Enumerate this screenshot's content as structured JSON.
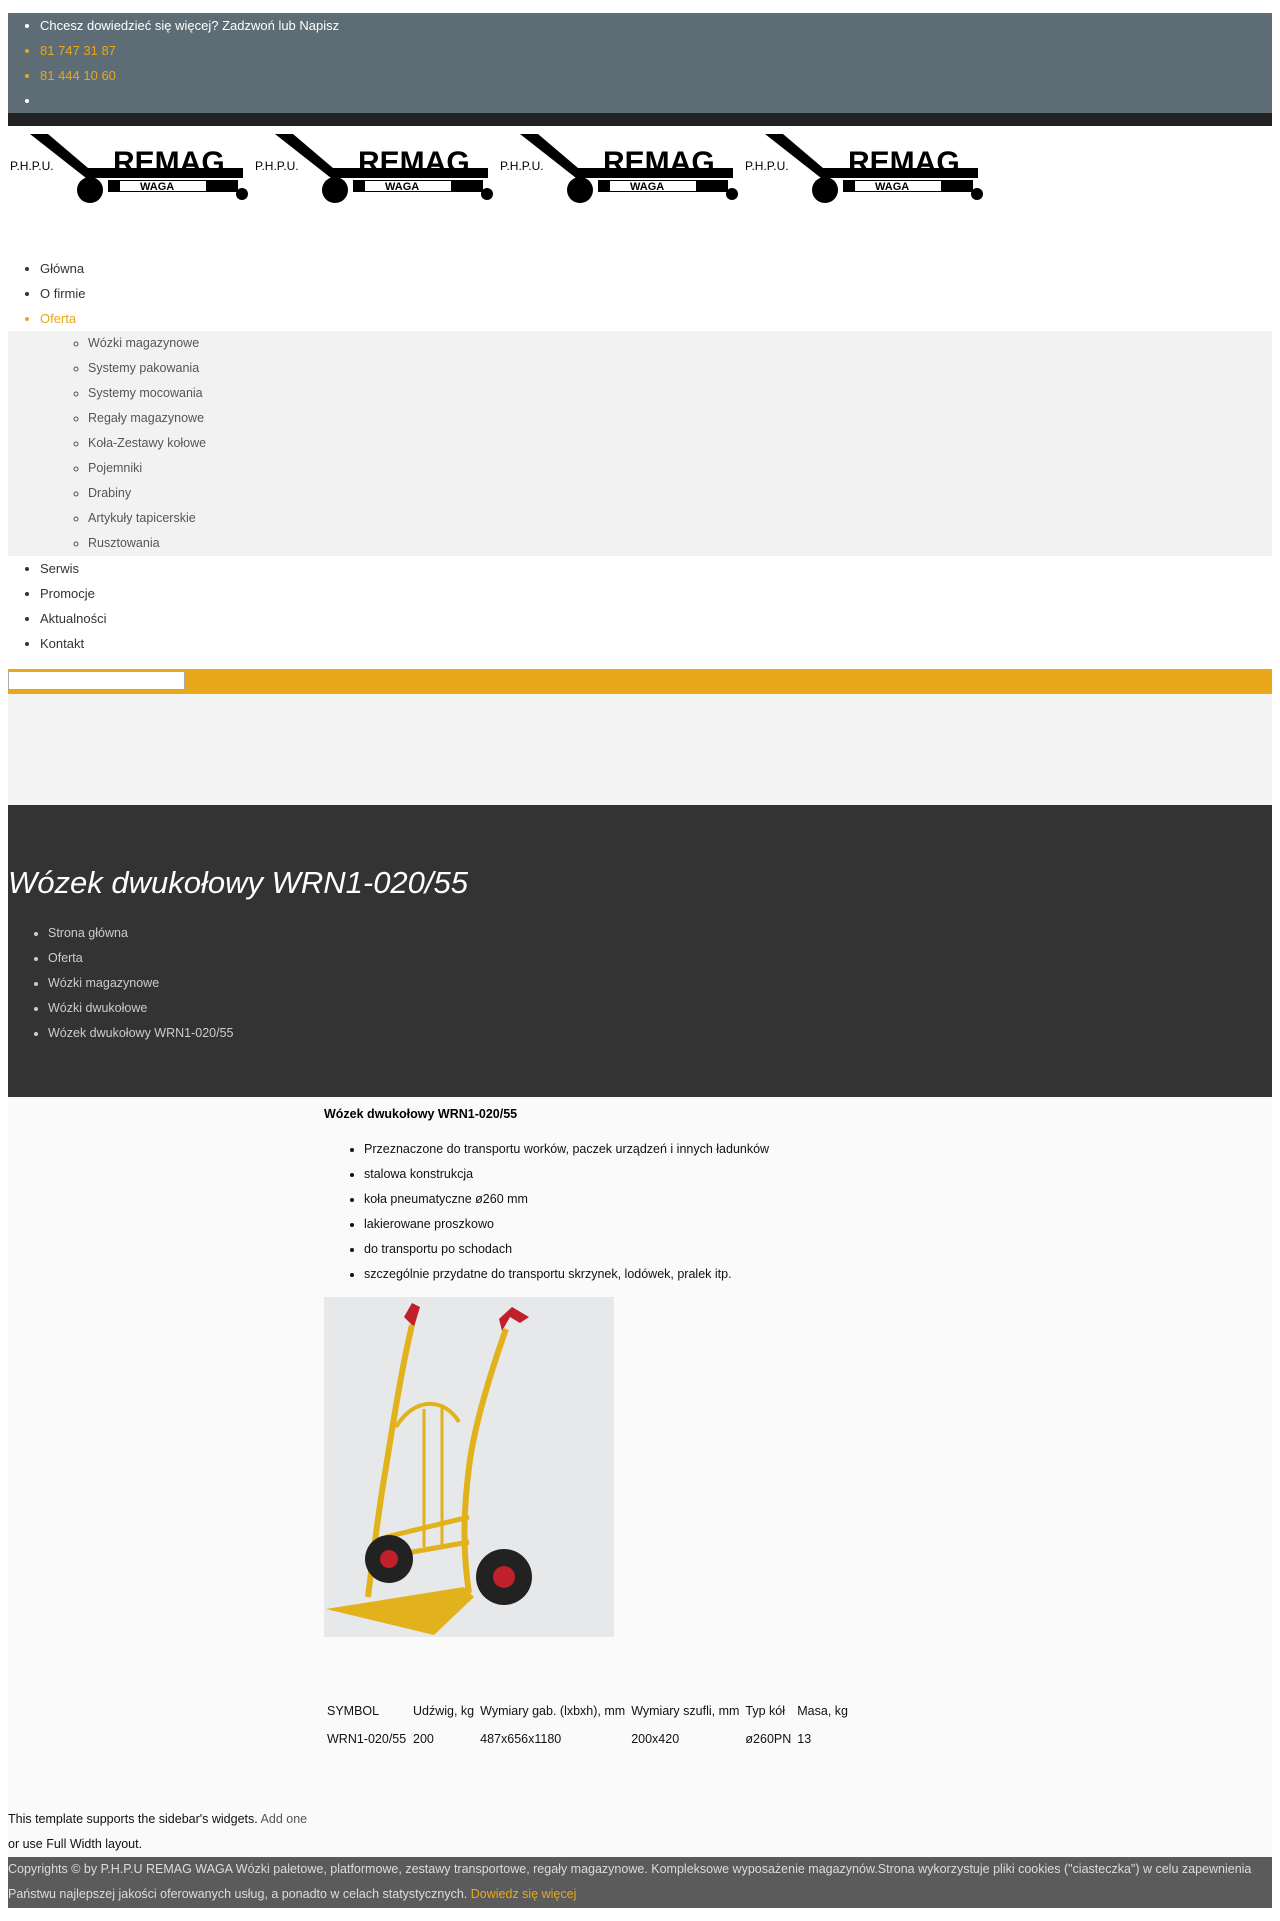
{
  "topbar": {
    "headline": "Chcesz dowiedzieć się więcej? Zadzwoń lub Napisz",
    "phone1": "81 747 31 87",
    "phone2": "81 444 10 60"
  },
  "logo": {
    "prefix": "P.H.P.U.",
    "brand": "REMAG",
    "sub": "WAGA"
  },
  "nav": {
    "items": [
      {
        "label": "Główna"
      },
      {
        "label": "O firmie"
      },
      {
        "label": "Oferta"
      },
      {
        "label": "Serwis"
      },
      {
        "label": "Promocje"
      },
      {
        "label": "Aktualności"
      },
      {
        "label": "Kontakt"
      }
    ],
    "submenu": [
      "Wózki magazynowe",
      "Systemy pakowania",
      "Systemy mocowania",
      "Regały magazynowe",
      "Koła-Zestawy kołowe",
      "Pojemniki",
      "Drabiny",
      "Artykuły tapicerskie",
      "Rusztowania"
    ]
  },
  "hero": {
    "title": "Wózek dwukołowy WRN1-020/55",
    "breadcrumb": [
      "Strona główna",
      "Oferta",
      "Wózki magazynowe",
      "Wózki dwukołowe",
      "Wózek dwukołowy WRN1-020/55"
    ]
  },
  "product": {
    "title": "Wózek dwukołowy WRN1-020/55",
    "features": [
      "Przeznaczone do transportu worków, paczek urządzeń i innych ładunków",
      "stalowa konstrukcja",
      "koła pneumatyczne ø260 mm",
      "lakierowane proszkowo",
      "do transportu po schodach",
      "szczególnie przydatne do transportu skrzynek, lodówek, pralek itp."
    ],
    "table": {
      "headers": [
        "SYMBOL",
        "Udźwig, kg",
        "Wymiary gab. (lxbxh), mm",
        "Wymiary szufli, mm",
        "Typ kół",
        "Masa, kg"
      ],
      "row": [
        "WRN1-020/55",
        "200",
        "487x656x1180",
        "200x420",
        "ø260PN",
        "13"
      ]
    }
  },
  "sidebar_note": {
    "line1": "This template supports the sidebar's widgets.",
    "add_link": "Add one",
    "line2": "or use Full Width layout."
  },
  "footer": {
    "text": "Copyrights © by P.H.P.U REMAG WAGA Wózki paletowe, platformowe, zestawy transportowe, regały magazynowe. Kompleksowe wyposażenie magazynów.Strona wykorzystuje pliki cookies (\"ciasteczka\") w celu zapewnienia Państwu najlepszej jakości oferowanych usług, a ponadto w celach statystycznych.",
    "link": "Dowiedz się więcej"
  },
  "colors": {
    "accent": "#e8a81a",
    "topbar": "#5e6d75",
    "hero": "#333333",
    "footer": "#5b5b5b"
  }
}
